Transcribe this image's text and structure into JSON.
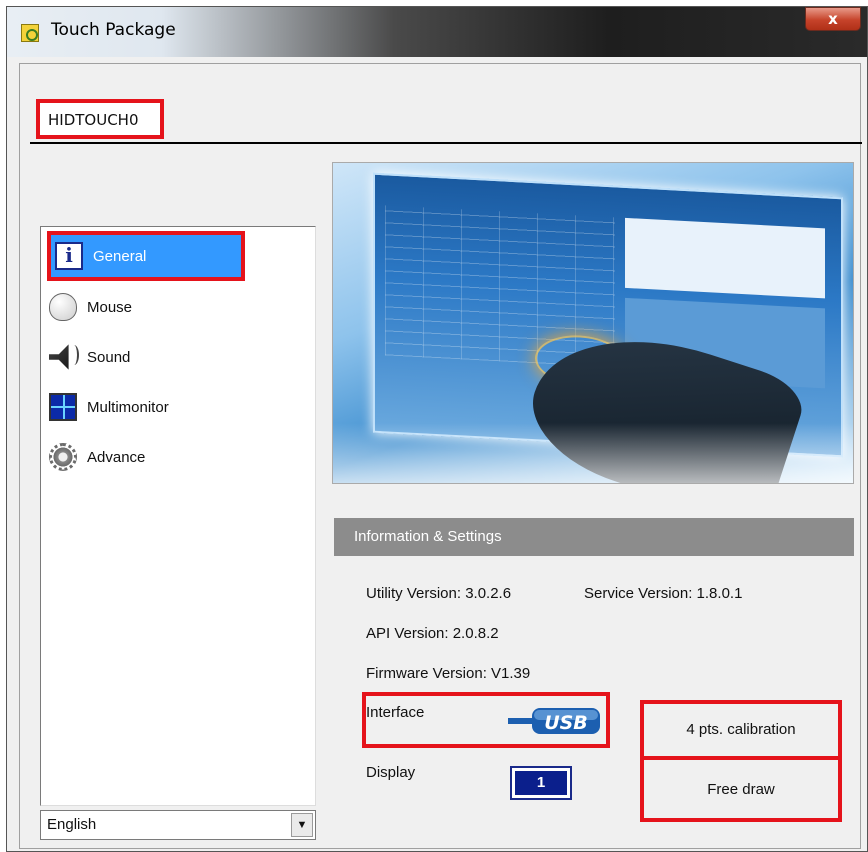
{
  "window": {
    "title": "Touch Package",
    "close_glyph": "x"
  },
  "tabs": [
    {
      "label": "HIDTOUCH0",
      "selected": true
    }
  ],
  "sidebar": {
    "items": [
      {
        "label": "General",
        "icon": "info-icon",
        "selected": true
      },
      {
        "label": "Mouse",
        "icon": "mouse-icon",
        "selected": false
      },
      {
        "label": "Sound",
        "icon": "speaker-icon",
        "selected": false
      },
      {
        "label": "Multimonitor",
        "icon": "monitor-icon",
        "selected": false
      },
      {
        "label": "Advance",
        "icon": "gear-icon",
        "selected": false
      }
    ],
    "language": {
      "selected": "English"
    }
  },
  "info": {
    "header": "Information & Settings",
    "utility_version": "Utility Version: 3.0.2.6",
    "service_version": "Service Version: 1.8.0.1",
    "api_version": "API Version: 2.0.8.2",
    "firmware_version": "Firmware Version: V1.39",
    "interface_label": "Interface",
    "interface_value": "USB",
    "display_label": "Display",
    "display_value": "1"
  },
  "actions": {
    "calibration": "4 pts. calibration",
    "free_draw": "Free draw"
  },
  "colors": {
    "highlight_red": "#e5131b",
    "selection_blue": "#3399ff",
    "header_gray": "#8c8c8c",
    "display_navy": "#0b1f8c"
  }
}
